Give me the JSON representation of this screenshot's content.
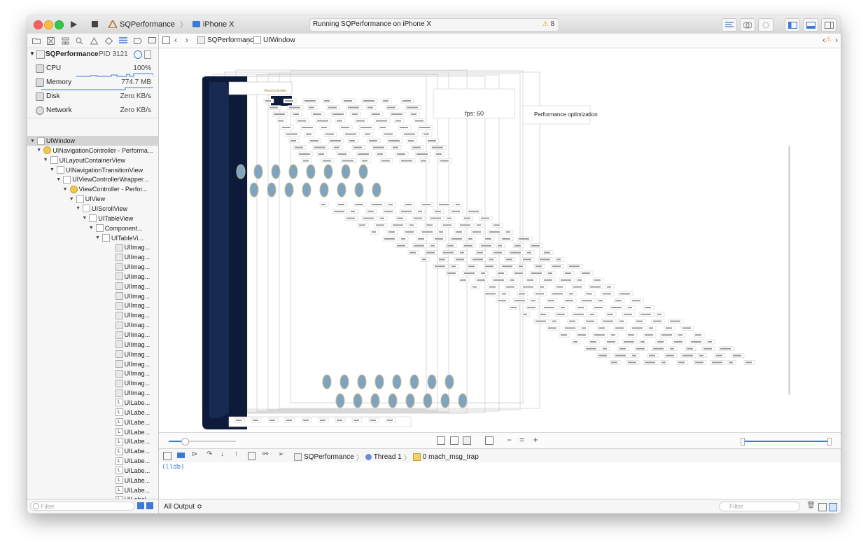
{
  "toolbar": {
    "scheme_name": "SQPerformance",
    "device_name": "iPhone X",
    "status": "Running SQPerformance on iPhone X",
    "warning_count": "8"
  },
  "navigator": {
    "process_name": "SQPerformance",
    "process_pid": "PID 3121",
    "metrics": [
      {
        "label": "CPU",
        "value": "100%"
      },
      {
        "label": "Memory",
        "value": "774.7 MB"
      },
      {
        "label": "Disk",
        "value": "Zero KB/s"
      },
      {
        "label": "Network",
        "value": "Zero KB/s"
      }
    ],
    "tree": [
      {
        "label": "UIWindow"
      },
      {
        "label": "UINavigationController - Performa..."
      },
      {
        "label": "UILayoutContainerView"
      },
      {
        "label": "UINavigationTransitionView"
      },
      {
        "label": "UIViewControllerWrapper..."
      },
      {
        "label": "ViewController - Perfor..."
      },
      {
        "label": "UIView"
      },
      {
        "label": "UIScrollView"
      },
      {
        "label": "UITableView"
      },
      {
        "label": "Component..."
      },
      {
        "label": "UITableVi..."
      },
      {
        "label": "UIImag..."
      },
      {
        "label": "UIImag..."
      },
      {
        "label": "UIImag..."
      },
      {
        "label": "UIImag..."
      },
      {
        "label": "UIImag..."
      },
      {
        "label": "UIImag..."
      },
      {
        "label": "UIImag..."
      },
      {
        "label": "UIImag..."
      },
      {
        "label": "UIImag..."
      },
      {
        "label": "UIImag..."
      },
      {
        "label": "UIImag..."
      },
      {
        "label": "UIImag..."
      },
      {
        "label": "UIImag..."
      },
      {
        "label": "UIImag..."
      },
      {
        "label": "UIImag..."
      },
      {
        "label": "UIImag..."
      },
      {
        "label": "UILabe..."
      },
      {
        "label": "UILabe..."
      },
      {
        "label": "UILabe..."
      },
      {
        "label": "UILabe..."
      },
      {
        "label": "UILabe..."
      },
      {
        "label": "UILabe..."
      },
      {
        "label": "UILabe..."
      },
      {
        "label": "UILabe..."
      },
      {
        "label": "UILabe..."
      },
      {
        "label": "UILabe..."
      },
      {
        "label": "UILabel"
      },
      {
        "label": "UILabe..."
      }
    ],
    "filter_placeholder": "Filter"
  },
  "jumpbar": {
    "crumb_app": "SQPerformance",
    "crumb_view": "UIWindow"
  },
  "canvas": {
    "fps_label": "fps: 60",
    "title_label": "Performance optimization",
    "vc_label": "ViewController"
  },
  "debug": {
    "crumb_app": "SQPerformance",
    "crumb_thread": "Thread 1",
    "crumb_frame": "0 mach_msg_trap"
  },
  "console": {
    "prompt": "(lldb)",
    "output_selector": "All Output ≎",
    "filter_placeholder": "Filter"
  }
}
